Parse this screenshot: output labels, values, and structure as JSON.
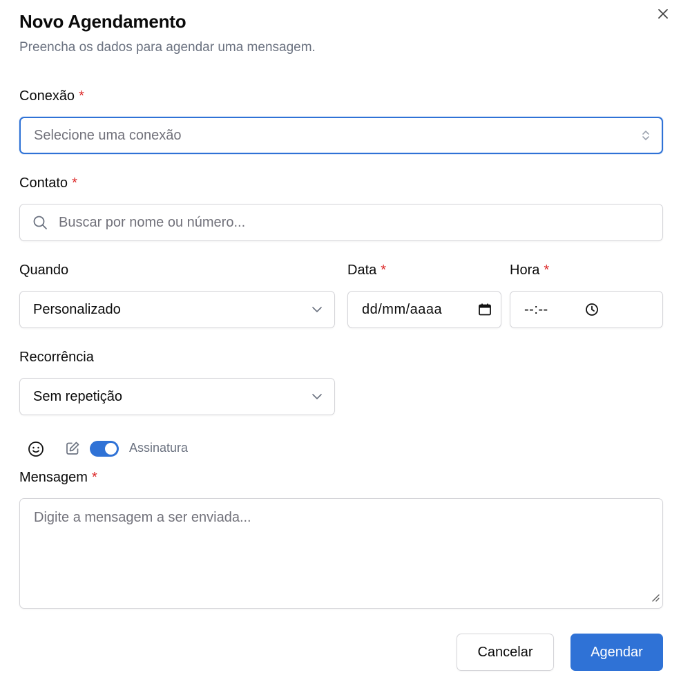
{
  "dialog": {
    "title": "Novo Agendamento",
    "subtitle": "Preencha os dados para agendar uma mensagem.",
    "close_icon": "close-icon"
  },
  "connection": {
    "label": "Conexão",
    "required_mark": "*",
    "placeholder": "Selecione uma conexão"
  },
  "contact": {
    "label": "Contato",
    "required_mark": "*",
    "placeholder": "Buscar por nome ou número..."
  },
  "when": {
    "label": "Quando",
    "value": "Personalizado"
  },
  "date": {
    "label": "Data",
    "required_mark": "*",
    "placeholder": "dd/mm/aaaa"
  },
  "time": {
    "label": "Hora",
    "required_mark": "*",
    "placeholder": "--:--"
  },
  "recurrence": {
    "label": "Recorrência",
    "value": "Sem repetição"
  },
  "toolbar": {
    "emoji_icon": "smiley-icon",
    "edit_icon": "pencil-square-icon",
    "signature_label": "Assinatura",
    "signature_on": true
  },
  "message": {
    "label": "Mensagem",
    "required_mark": "*",
    "placeholder": "Digite a mensagem a ser enviada..."
  },
  "actions": {
    "cancel_label": "Cancelar",
    "submit_label": "Agendar"
  },
  "colors": {
    "primary": "#2f72d6",
    "required": "#dc2626",
    "muted": "#6b7280"
  }
}
